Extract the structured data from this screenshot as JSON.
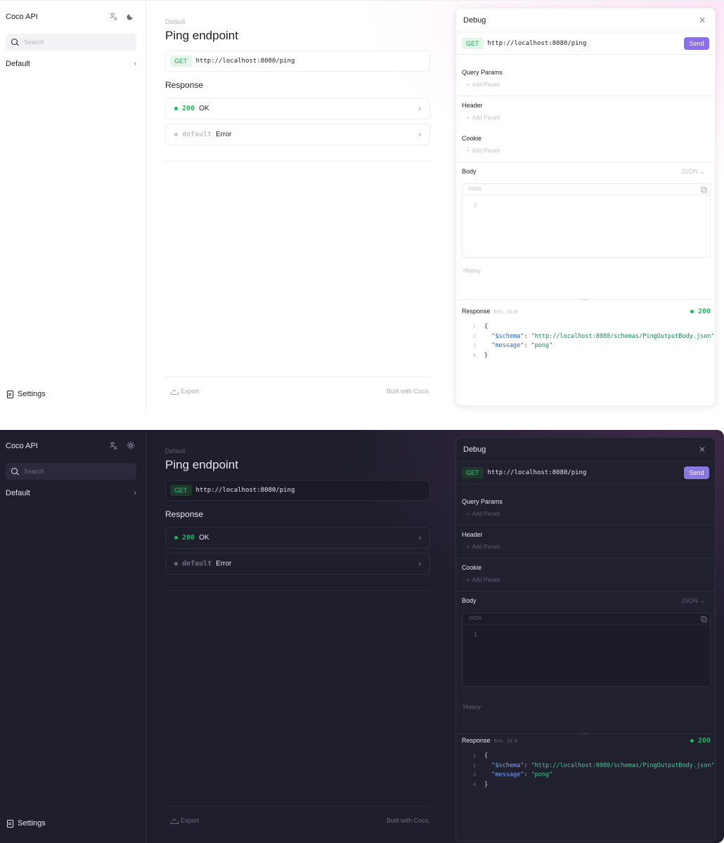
{
  "app": {
    "title": "Coco API",
    "search_placeholder": "Search",
    "nav_default": "Default",
    "settings": "Settings",
    "translate_icon": "translate-icon",
    "theme_icon_light": "moon-icon",
    "theme_icon_dark": "sun-icon"
  },
  "main": {
    "breadcrumb": "Default",
    "title": "Ping endpoint",
    "method": "GET",
    "url": "http://localhost:8080/ping",
    "response_title": "Response",
    "responses": [
      {
        "code": "200",
        "text": "OK",
        "color": "#1fb55a"
      },
      {
        "code": "default",
        "text": "Error",
        "color": "#b5b5bd"
      }
    ],
    "export": "Export",
    "built_with": "Built with Coco."
  },
  "debug": {
    "title": "Debug",
    "method": "GET",
    "url": "http://localhost:8080/ping",
    "send": "Send",
    "query_params": "Query Params",
    "header": "Header",
    "cookie": "Cookie",
    "add_param": "Add Param",
    "body": "Body",
    "body_type": "JSON",
    "editor_label": "JSON",
    "editor_line": "1",
    "history": "History",
    "dots": "...",
    "response_label": "Response",
    "response_meta": "9ms · 81 B",
    "response_status": "200",
    "code_lines": [
      {
        "n": "1",
        "parts": [
          {
            "t": "p",
            "v": "{"
          }
        ]
      },
      {
        "n": "2",
        "parts": [
          {
            "t": "p",
            "v": "  "
          },
          {
            "t": "k",
            "v": "\"$schema\""
          },
          {
            "t": "p",
            "v": ": "
          },
          {
            "t": "s",
            "v": "\"http://localhost:8080/schemas/PingOutputBody.json\""
          },
          {
            "t": "p",
            "v": ","
          }
        ]
      },
      {
        "n": "3",
        "parts": [
          {
            "t": "p",
            "v": "  "
          },
          {
            "t": "k",
            "v": "\"message\""
          },
          {
            "t": "p",
            "v": ": "
          },
          {
            "t": "s",
            "v": "\"pong\""
          }
        ]
      },
      {
        "n": "4",
        "parts": [
          {
            "t": "p",
            "v": "}"
          }
        ]
      }
    ]
  },
  "colors": {
    "accent": "#8a6ef0",
    "success": "#1fb55a",
    "get_badge": "#1fa45a"
  }
}
